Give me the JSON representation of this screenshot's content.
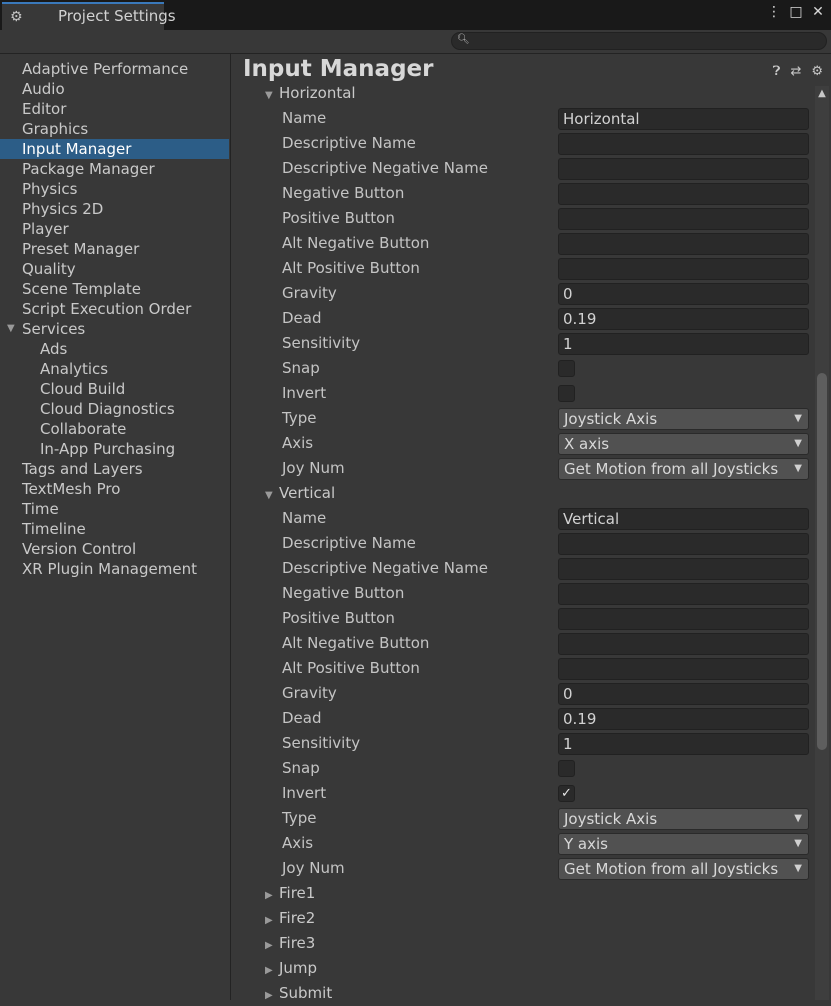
{
  "window": {
    "title": "Project Settings",
    "menu_glyph": "⋮",
    "maximize_glyph": "□",
    "close_glyph": "✕"
  },
  "search": {
    "placeholder": "",
    "value": ""
  },
  "sidebar": {
    "items": [
      {
        "label": "Adaptive Performance",
        "indent": 0
      },
      {
        "label": "Audio",
        "indent": 0
      },
      {
        "label": "Editor",
        "indent": 0
      },
      {
        "label": "Graphics",
        "indent": 0
      },
      {
        "label": "Input Manager",
        "indent": 0,
        "selected": true
      },
      {
        "label": "Package Manager",
        "indent": 0
      },
      {
        "label": "Physics",
        "indent": 0
      },
      {
        "label": "Physics 2D",
        "indent": 0
      },
      {
        "label": "Player",
        "indent": 0
      },
      {
        "label": "Preset Manager",
        "indent": 0
      },
      {
        "label": "Quality",
        "indent": 0
      },
      {
        "label": "Scene Template",
        "indent": 0
      },
      {
        "label": "Script Execution Order",
        "indent": 0
      },
      {
        "label": "Services",
        "indent": 0,
        "expanded": true
      },
      {
        "label": "Ads",
        "indent": 1
      },
      {
        "label": "Analytics",
        "indent": 1
      },
      {
        "label": "Cloud Build",
        "indent": 1
      },
      {
        "label": "Cloud Diagnostics",
        "indent": 1
      },
      {
        "label": "Collaborate",
        "indent": 1
      },
      {
        "label": "In-App Purchasing",
        "indent": 1
      },
      {
        "label": "Tags and Layers",
        "indent": 0
      },
      {
        "label": "TextMesh Pro",
        "indent": 0
      },
      {
        "label": "Time",
        "indent": 0
      },
      {
        "label": "Timeline",
        "indent": 0
      },
      {
        "label": "Version Control",
        "indent": 0
      },
      {
        "label": "XR Plugin Management",
        "indent": 0
      }
    ]
  },
  "main": {
    "title": "Input Manager",
    "icons": [
      "help-icon",
      "preset-icon",
      "gear-icon"
    ],
    "scroll_position": 0.52,
    "scroll_visible_fraction": 0.42,
    "rows": [
      {
        "kind": "foldout",
        "label": "Horizontal",
        "open": true
      },
      {
        "kind": "text",
        "label": "Name",
        "value": "Horizontal"
      },
      {
        "kind": "text",
        "label": "Descriptive Name",
        "value": ""
      },
      {
        "kind": "text",
        "label": "Descriptive Negative Name",
        "value": ""
      },
      {
        "kind": "text",
        "label": "Negative Button",
        "value": ""
      },
      {
        "kind": "text",
        "label": "Positive Button",
        "value": ""
      },
      {
        "kind": "text",
        "label": "Alt Negative Button",
        "value": ""
      },
      {
        "kind": "text",
        "label": "Alt Positive Button",
        "value": ""
      },
      {
        "kind": "text",
        "label": "Gravity",
        "value": "0"
      },
      {
        "kind": "text",
        "label": "Dead",
        "value": "0.19"
      },
      {
        "kind": "text",
        "label": "Sensitivity",
        "value": "1"
      },
      {
        "kind": "check",
        "label": "Snap",
        "checked": false
      },
      {
        "kind": "check",
        "label": "Invert",
        "checked": false
      },
      {
        "kind": "dropdown",
        "label": "Type",
        "value": "Joystick Axis"
      },
      {
        "kind": "dropdown",
        "label": "Axis",
        "value": "X axis"
      },
      {
        "kind": "dropdown",
        "label": "Joy Num",
        "value": "Get Motion from all Joysticks"
      },
      {
        "kind": "foldout",
        "label": "Vertical",
        "open": true
      },
      {
        "kind": "text",
        "label": "Name",
        "value": "Vertical"
      },
      {
        "kind": "text",
        "label": "Descriptive Name",
        "value": ""
      },
      {
        "kind": "text",
        "label": "Descriptive Negative Name",
        "value": ""
      },
      {
        "kind": "text",
        "label": "Negative Button",
        "value": ""
      },
      {
        "kind": "text",
        "label": "Positive Button",
        "value": ""
      },
      {
        "kind": "text",
        "label": "Alt Negative Button",
        "value": ""
      },
      {
        "kind": "text",
        "label": "Alt Positive Button",
        "value": ""
      },
      {
        "kind": "text",
        "label": "Gravity",
        "value": "0"
      },
      {
        "kind": "text",
        "label": "Dead",
        "value": "0.19"
      },
      {
        "kind": "text",
        "label": "Sensitivity",
        "value": "1"
      },
      {
        "kind": "check",
        "label": "Snap",
        "checked": false
      },
      {
        "kind": "check",
        "label": "Invert",
        "checked": true
      },
      {
        "kind": "dropdown",
        "label": "Type",
        "value": "Joystick Axis"
      },
      {
        "kind": "dropdown",
        "label": "Axis",
        "value": "Y axis"
      },
      {
        "kind": "dropdown",
        "label": "Joy Num",
        "value": "Get Motion from all Joysticks"
      },
      {
        "kind": "foldout",
        "label": "Fire1",
        "open": false
      },
      {
        "kind": "foldout",
        "label": "Fire2",
        "open": false
      },
      {
        "kind": "foldout",
        "label": "Fire3",
        "open": false
      },
      {
        "kind": "foldout",
        "label": "Jump",
        "open": false
      },
      {
        "kind": "foldout",
        "label": "Submit",
        "open": false
      }
    ]
  },
  "colors": {
    "selection": "#2c5d87",
    "tab_accent": "#3a79bb",
    "panel": "#383838",
    "field": "#2a2a2a",
    "dropdown": "#515151"
  }
}
